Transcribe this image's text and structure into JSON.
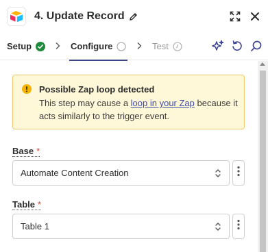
{
  "header": {
    "title": "4. Update Record",
    "app_icon": "airtable-logo-icon",
    "actions": [
      "expand-icon",
      "close-icon"
    ]
  },
  "tabs": [
    {
      "label": "Setup",
      "status": "complete"
    },
    {
      "label": "Configure",
      "status": "active"
    },
    {
      "label": "Test",
      "status": "pending"
    }
  ],
  "alert": {
    "title": "Possible Zap loop detected",
    "body_before": "This step may cause a ",
    "link_text": "loop in your Zap",
    "body_after": " because it acts similarly to the trigger event."
  },
  "fields": {
    "base": {
      "label": "Base",
      "required": "*",
      "value": "Automate Content Creation"
    },
    "table": {
      "label": "Table",
      "required": "*",
      "value": "Table 1"
    }
  },
  "colors": {
    "accent": "#3d4592",
    "success": "#1f8a3b",
    "warning_bg": "#fff8d8",
    "warning_border": "#eacb68",
    "required": "#d6402f"
  }
}
